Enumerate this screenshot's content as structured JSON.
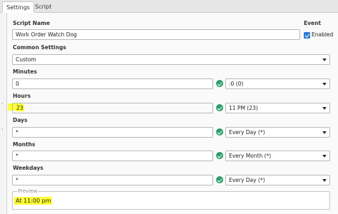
{
  "tabs": [
    {
      "label": "Settings",
      "active": true
    },
    {
      "label": "Script",
      "active": false
    }
  ],
  "form": {
    "script_name": {
      "label": "Script Name",
      "value": "Work Order Watch Dog"
    },
    "event": {
      "label": "Event",
      "checkbox_label": "Enabled",
      "checked": true
    },
    "common_settings": {
      "label": "Common Settings",
      "value": "Custom"
    },
    "minutes": {
      "label": "Minutes",
      "value": "0",
      "option": ":0 (0)"
    },
    "hours": {
      "label": "Hours",
      "value": "23",
      "option": "11 PM (23)"
    },
    "days": {
      "label": "Days",
      "value": "*",
      "option": "Every Day (*)"
    },
    "months": {
      "label": "Months",
      "value": "*",
      "option": "Every Month (*)"
    },
    "weekdays": {
      "label": "Weekdays",
      "value": "*",
      "option": "Every Day (*)"
    },
    "preview": {
      "legend": "Preview",
      "value": "At 11:00 pm"
    }
  },
  "colors": {
    "accent": "#2d7dd2",
    "valid": "#2a9d6a",
    "highlight": "#ffff33"
  }
}
